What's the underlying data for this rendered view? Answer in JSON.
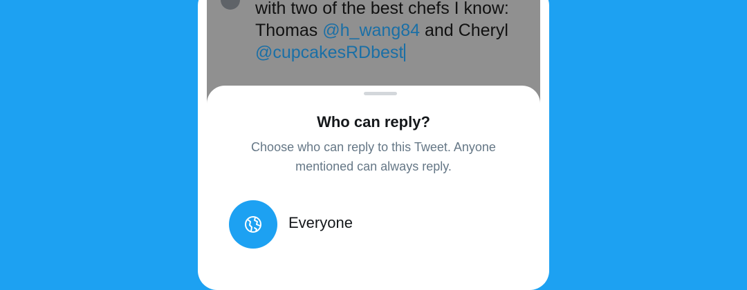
{
  "tweet": {
    "line1": "with two of the best chefs I know:",
    "line2_prefix": "Thomas ",
    "mention1": "@h_wang84",
    "line2_middle": " and Cheryl",
    "mention2": "@cupcakesRDbest"
  },
  "sheet": {
    "title": "Who can reply?",
    "subtitle_line1": "Choose who can reply to this Tweet. Anyone",
    "subtitle_line2": "mentioned can always reply.",
    "options": [
      {
        "label": "Everyone",
        "icon": "globe-icon"
      }
    ]
  },
  "colors": {
    "background": "#1da1f2",
    "accent": "#1da1f2",
    "mention": "#1a6fa6",
    "overlay": "#909090"
  }
}
